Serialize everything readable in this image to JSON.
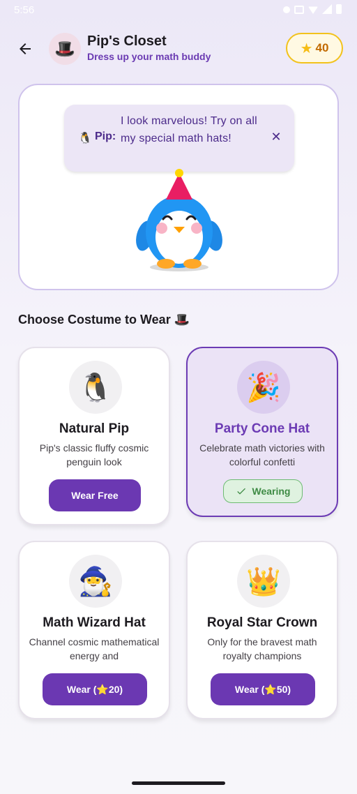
{
  "status_bar": {
    "time": "5:56"
  },
  "header": {
    "title": "Pip's Closet",
    "subtitle": "Dress up your math buddy",
    "avatar_emoji": "🎩",
    "stars": "40"
  },
  "bubble": {
    "speaker_emoji": "🐧",
    "speaker": "Pip:",
    "message": "I look marvelous! Try on all my special math hats!",
    "close_label": "✕"
  },
  "section_title": "Choose Costume to Wear 🎩",
  "costumes": [
    {
      "emoji": "🐧",
      "name": "Natural Pip",
      "description": "Pip's classic fluffy cosmic penguin look",
      "action": "Wear Free",
      "state": "available"
    },
    {
      "emoji": "🎉",
      "name": "Party Cone Hat",
      "description": "Celebrate math victories with colorful confetti",
      "action": "Wearing",
      "state": "wearing"
    },
    {
      "emoji": "🧙‍♂️",
      "name": "Math Wizard Hat",
      "description": "Channel cosmic mathematical energy and",
      "action": "Wear (⭐20)",
      "state": "locked"
    },
    {
      "emoji": "👑",
      "name": "Royal Star Crown",
      "description": "Only for the bravest math royalty champions",
      "action": "Wear (⭐50)",
      "state": "locked"
    }
  ],
  "colors": {
    "accent": "#6b38b2",
    "selected_card_bg": "#ebe3f6",
    "wearing_green": "#3f8b45",
    "star_gold": "#f6bd16"
  },
  "icons": {
    "back": "arrow-left-icon",
    "star": "star-icon",
    "close": "close-icon",
    "check": "check-icon"
  }
}
